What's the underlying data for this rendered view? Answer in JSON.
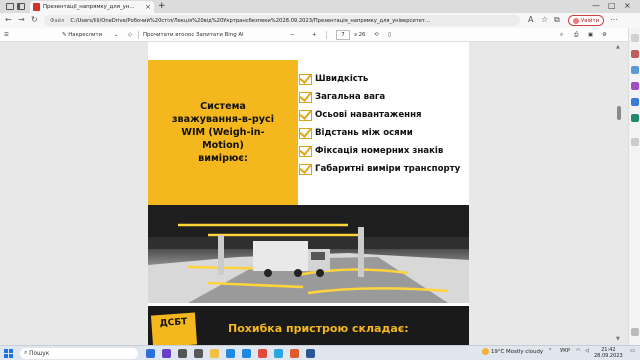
{
  "browser": {
    "tab_title": "Презентації_напрямку_для_ун...",
    "tab_close": "×",
    "new_tab": "+",
    "file_label": "Файл",
    "url": "C:/Users/lili/OneDrive/Робочий%20стіл/Лекція%20від%20Укртрансбезпеки%2028.09.2023/Презентація_напрямку_для_університет...",
    "profile_label": "Увійти",
    "window_controls": [
      "—",
      "□",
      "×"
    ]
  },
  "pdf_toolbar": {
    "draw": "Накреслити",
    "read_aloud": "Прочитати вголос",
    "ask_bing": "Запитати Bing AI",
    "page_current": "7",
    "page_total": "з 26",
    "zoom_out": "−",
    "zoom_in": "+"
  },
  "slide1": {
    "heading_lines": [
      "Система",
      "зважування-в-русі",
      "WIM (Weigh-in-",
      "Motion)",
      "вимірює:"
    ],
    "items": [
      "Швидкість",
      "Загальна вага",
      "Осьові навантаження",
      "Відстань між осями",
      "Фіксація номерних знаків",
      "Габаритні виміри транспорту"
    ]
  },
  "slide2": {
    "logo": "ДСБТ",
    "title": "Похибка пристрою складає:"
  },
  "taskbar": {
    "search_placeholder": "Пошук",
    "weather": "19°C  Mostly cloudy",
    "lang": "УКР",
    "time": "21:42",
    "date": "28.09.2023"
  },
  "colors": {
    "accent_yellow": "#f4b71d",
    "pdf_red": "#d32f2f",
    "profile_red": "#c94343"
  }
}
